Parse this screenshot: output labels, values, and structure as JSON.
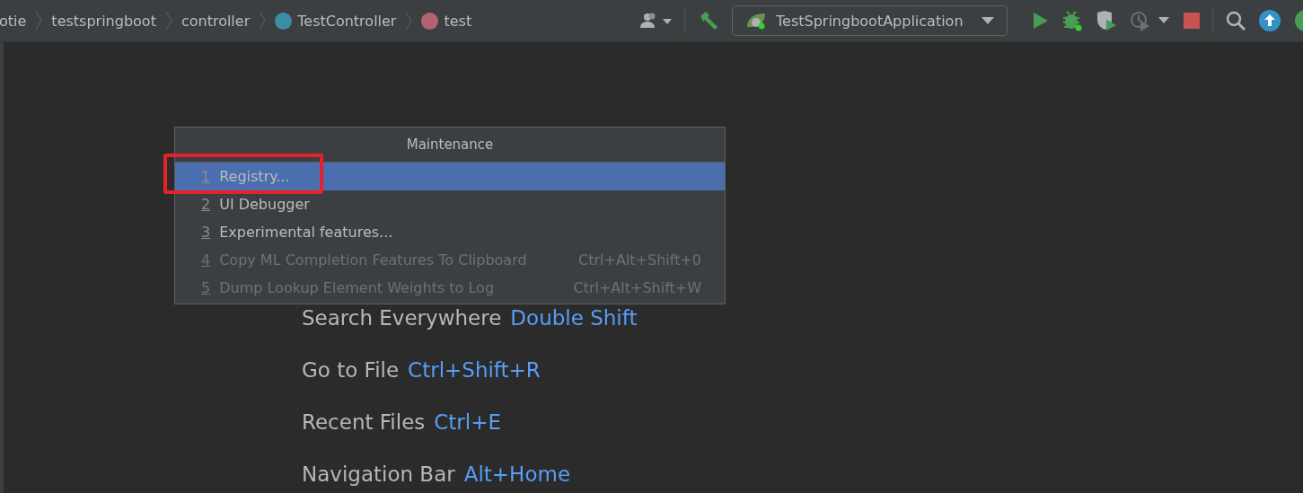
{
  "breadcrumbs": [
    {
      "label": "otie",
      "kind": "folder"
    },
    {
      "label": "testspringboot",
      "kind": "folder"
    },
    {
      "label": "controller",
      "kind": "folder"
    },
    {
      "label": "TestController",
      "kind": "class"
    },
    {
      "label": "test",
      "kind": "method"
    }
  ],
  "run_configuration": {
    "label": "TestSpringbootApplication"
  },
  "popup": {
    "title": "Maintenance",
    "items": [
      {
        "mnemonic": "1",
        "label": "Registry...",
        "selected": true,
        "disabled": false
      },
      {
        "mnemonic": "2",
        "label": "UI Debugger",
        "selected": false,
        "disabled": false
      },
      {
        "mnemonic": "3",
        "label": "Experimental features...",
        "selected": false,
        "disabled": false
      },
      {
        "mnemonic": "4",
        "label": "Copy ML Completion Features To Clipboard",
        "shortcut": "Ctrl+Alt+Shift+0",
        "selected": false,
        "disabled": true
      },
      {
        "mnemonic": "5",
        "label": "Dump Lookup Element Weights to Log",
        "shortcut": "Ctrl+Alt+Shift+W",
        "selected": false,
        "disabled": true
      }
    ]
  },
  "hints": [
    {
      "action": "Search Everywhere",
      "shortcut": "Double Shift"
    },
    {
      "action": "Go to File",
      "shortcut": "Ctrl+Shift+R"
    },
    {
      "action": "Recent Files",
      "shortcut": "Ctrl+E"
    },
    {
      "action": "Navigation Bar",
      "shortcut": "Alt+Home"
    }
  ]
}
